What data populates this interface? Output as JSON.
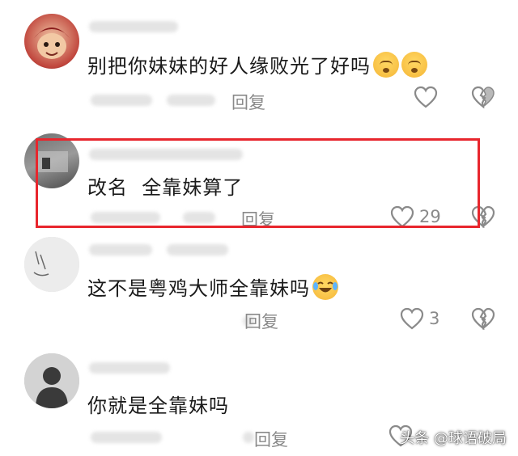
{
  "comments": [
    {
      "text": "别把你妹妹的好人缘败光了好吗",
      "emojis": [
        "yawning-face-emoji",
        "yawning-face-emoji"
      ],
      "reply_label": "回复",
      "likes": "",
      "avatar_icon": "anime-face-avatar"
    },
    {
      "text": "改名  全靠妹算了",
      "reply_label": "回复",
      "likes": "29",
      "avatar_icon": "gray-photo-avatar",
      "highlighted": true
    },
    {
      "text": "这不是粤鸡大师全靠妹吗",
      "emojis": [
        "crying-laughing-emoji"
      ],
      "reply_label": "回复",
      "likes": "3",
      "avatar_icon": "sketch-avatar"
    },
    {
      "text": "你就是全靠妹吗",
      "reply_label": "回复",
      "likes": "",
      "avatar_icon": "person-silhouette-avatar"
    }
  ],
  "icons": {
    "like": "heart-outline-icon",
    "dislike": "broken-heart-icon"
  },
  "highlight_color": "#e8262d",
  "watermark": "头条 @球语破局"
}
